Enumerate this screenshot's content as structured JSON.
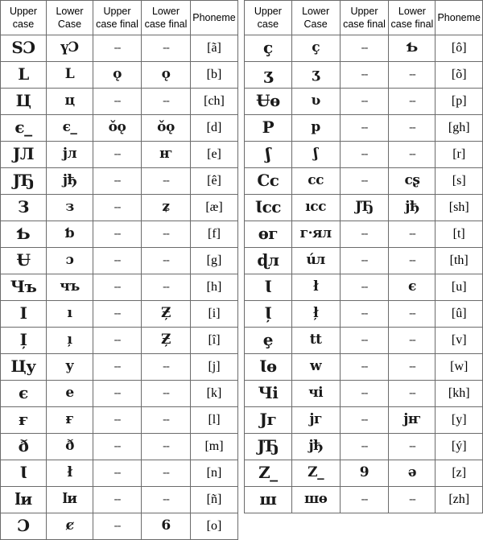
{
  "page": {
    "title": "Caucasian Albanian alphabet chart",
    "background_color": "#ffffff",
    "border_color": "#6b6b6b",
    "text_color": "#000000"
  },
  "headers": {
    "upper_case": [
      "Upper",
      "case"
    ],
    "lower_case": [
      "Lower",
      "Case"
    ],
    "upper_case_final": [
      "Upper",
      "case final"
    ],
    "lower_case_final": [
      "Lower",
      "case final"
    ],
    "phoneme": [
      "Phoneme",
      ""
    ]
  },
  "dash": "--",
  "tables": [
    {
      "id": "table-left",
      "rows": [
        {
          "upper": "ЅƆ",
          "lower": "үƆ",
          "upper_final": "--",
          "lower_final": "--",
          "phoneme": "[ã]"
        },
        {
          "upper": "L",
          "lower": "L",
          "upper_final": "ǫ",
          "lower_final": "ǫ",
          "phoneme": "[b]"
        },
        {
          "upper": "Ц",
          "lower": "ц",
          "upper_final": "--",
          "lower_final": "--",
          "phoneme": "[ch]"
        },
        {
          "upper": "є_",
          "lower": "є_",
          "upper_final": "ǒǫ",
          "lower_final": "ǒǫ",
          "phoneme": "[d]"
        },
        {
          "upper": "ЈЛ",
          "lower": "јл",
          "upper_final": "--",
          "lower_final": "ҥ",
          "phoneme": "[e]"
        },
        {
          "upper": "ЈЂ",
          "lower": "јђ",
          "upper_final": "--",
          "lower_final": "--",
          "phoneme": "[ê]"
        },
        {
          "upper": "З",
          "lower": "з",
          "upper_final": "--",
          "lower_final": "ʑ",
          "phoneme": "[æ]"
        },
        {
          "upper": "Ƅ",
          "lower": "ƅ",
          "upper_final": "--",
          "lower_final": "--",
          "phoneme": "[f]"
        },
        {
          "upper": "Ʉ",
          "lower": "ɔ",
          "upper_final": "--",
          "lower_final": "--",
          "phoneme": "[g]"
        },
        {
          "upper": "Чъ",
          "lower": "чъ",
          "upper_final": "--",
          "lower_final": "--",
          "phoneme": "[h]"
        },
        {
          "upper": "I",
          "lower": "ı",
          "upper_final": "--",
          "lower_final": "Ƶ̦",
          "phoneme": "[i]"
        },
        {
          "upper": "I̦",
          "lower": "ı̦",
          "upper_final": "--",
          "lower_final": "Ƶ̦",
          "phoneme": "[î]"
        },
        {
          "upper": "Цу",
          "lower": "у",
          "upper_final": "--",
          "lower_final": "--",
          "phoneme": "[j]"
        },
        {
          "upper": "є",
          "lower": "e",
          "upper_final": "--",
          "lower_final": "--",
          "phoneme": "[k]"
        },
        {
          "upper": "ғ",
          "lower": "ғ",
          "upper_final": "--",
          "lower_final": "--",
          "phoneme": "[l]"
        },
        {
          "upper": "ð",
          "lower": "ð",
          "upper_final": "--",
          "lower_final": "--",
          "phoneme": "[m]"
        },
        {
          "upper": "Ɩ",
          "lower": "ł",
          "upper_final": "--",
          "lower_final": "--",
          "phoneme": "[n]"
        },
        {
          "upper": "ӏи",
          "lower": "ӏи",
          "upper_final": "--",
          "lower_final": "--",
          "phoneme": "[ñ]"
        },
        {
          "upper": "Ɔ",
          "lower": "ȼ",
          "upper_final": "--",
          "lower_final": "6",
          "phoneme": "[o]"
        }
      ]
    },
    {
      "id": "table-right",
      "rows": [
        {
          "upper": "ç",
          "lower": "ç",
          "upper_final": "--",
          "lower_final": "Ƅ",
          "phoneme": "[ô]"
        },
        {
          "upper": "ʒ",
          "lower": "ʒ",
          "upper_final": "--",
          "lower_final": "--",
          "phoneme": "[õ]"
        },
        {
          "upper": "Ʉѳ",
          "lower": "ʋ",
          "upper_final": "--",
          "lower_final": "--",
          "phoneme": "[p]"
        },
        {
          "upper": "Р",
          "lower": "р",
          "upper_final": "--",
          "lower_final": "--",
          "phoneme": "[gh]"
        },
        {
          "upper": "ʃ",
          "lower": "ʃ",
          "upper_final": "--",
          "lower_final": "--",
          "phoneme": "[r]"
        },
        {
          "upper": "Cc",
          "lower": "cc",
          "upper_final": "--",
          "lower_final": "cʂ",
          "phoneme": "[s]"
        },
        {
          "upper": "Ɩcc",
          "lower": "ıcc",
          "upper_final": "ЈЂ",
          "lower_final": "јђ",
          "phoneme": "[sh]"
        },
        {
          "upper": "ѳг",
          "lower": "г·ял",
          "upper_final": "--",
          "lower_final": "--",
          "phoneme": "[t]"
        },
        {
          "upper": "ɖл",
          "lower": "úл",
          "upper_final": "--",
          "lower_final": "--",
          "phoneme": "[th]"
        },
        {
          "upper": "Ɩ",
          "lower": "ł",
          "upper_final": "--",
          "lower_final": "є",
          "phoneme": "[u]"
        },
        {
          "upper": "Ɩ̦",
          "lower": "ł̦",
          "upper_final": "--",
          "lower_final": "--",
          "phoneme": "[û]"
        },
        {
          "upper": "ȩ",
          "lower": "tt",
          "upper_final": "--",
          "lower_final": "--",
          "phoneme": "[v]"
        },
        {
          "upper": "Ɩѳ",
          "lower": "w",
          "upper_final": "--",
          "lower_final": "--",
          "phoneme": "[w]"
        },
        {
          "upper": "Чі",
          "lower": "чі",
          "upper_final": "--",
          "lower_final": "--",
          "phoneme": "[kh]"
        },
        {
          "upper": "Јг",
          "lower": "јг",
          "upper_final": "--",
          "lower_final": "јҥ",
          "phoneme": "[y]"
        },
        {
          "upper": "ЈЂ",
          "lower": "јђ",
          "upper_final": "--",
          "lower_final": "--",
          "phoneme": "[ý]"
        },
        {
          "upper": "Z_",
          "lower": "Z_",
          "upper_final": "9",
          "lower_final": "ə",
          "phoneme": "[z]"
        },
        {
          "upper": "ш",
          "lower": "шѳ",
          "upper_final": "--",
          "lower_final": "--",
          "phoneme": "[zh]"
        }
      ]
    }
  ]
}
